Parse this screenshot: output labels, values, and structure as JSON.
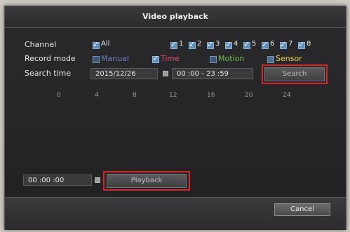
{
  "window": {
    "title": "Video playback"
  },
  "channel": {
    "label": "Channel",
    "all_label": "All",
    "all_checked": true,
    "channels": [
      {
        "label": "1",
        "checked": true
      },
      {
        "label": "2",
        "checked": true
      },
      {
        "label": "3",
        "checked": true
      },
      {
        "label": "4",
        "checked": true
      },
      {
        "label": "5",
        "checked": true
      },
      {
        "label": "6",
        "checked": true
      },
      {
        "label": "7",
        "checked": true
      },
      {
        "label": "8",
        "checked": true
      }
    ]
  },
  "record_mode": {
    "label": "Record mode",
    "options": [
      {
        "label": "Manual",
        "checked": false,
        "color": "#6f7bc2"
      },
      {
        "label": "Time",
        "checked": true,
        "color": "#e0486a"
      },
      {
        "label": "Motion",
        "checked": false,
        "color": "#6fbf4a"
      },
      {
        "label": "Sensor",
        "checked": false,
        "color": "#e8d24a"
      }
    ]
  },
  "search_time": {
    "label": "Search time",
    "date": "2015/12/26",
    "time_range": "00 :00  -  23 :59",
    "search_button": "Search"
  },
  "timeline": {
    "ticks": [
      "0",
      "4",
      "8",
      "12",
      "16",
      "20",
      "24"
    ]
  },
  "playback": {
    "time_value": "00 :00 :00",
    "playback_button": "Playback"
  },
  "footer": {
    "cancel_button": "Cancel"
  },
  "colors": {
    "highlight_border": "#d8262c"
  }
}
